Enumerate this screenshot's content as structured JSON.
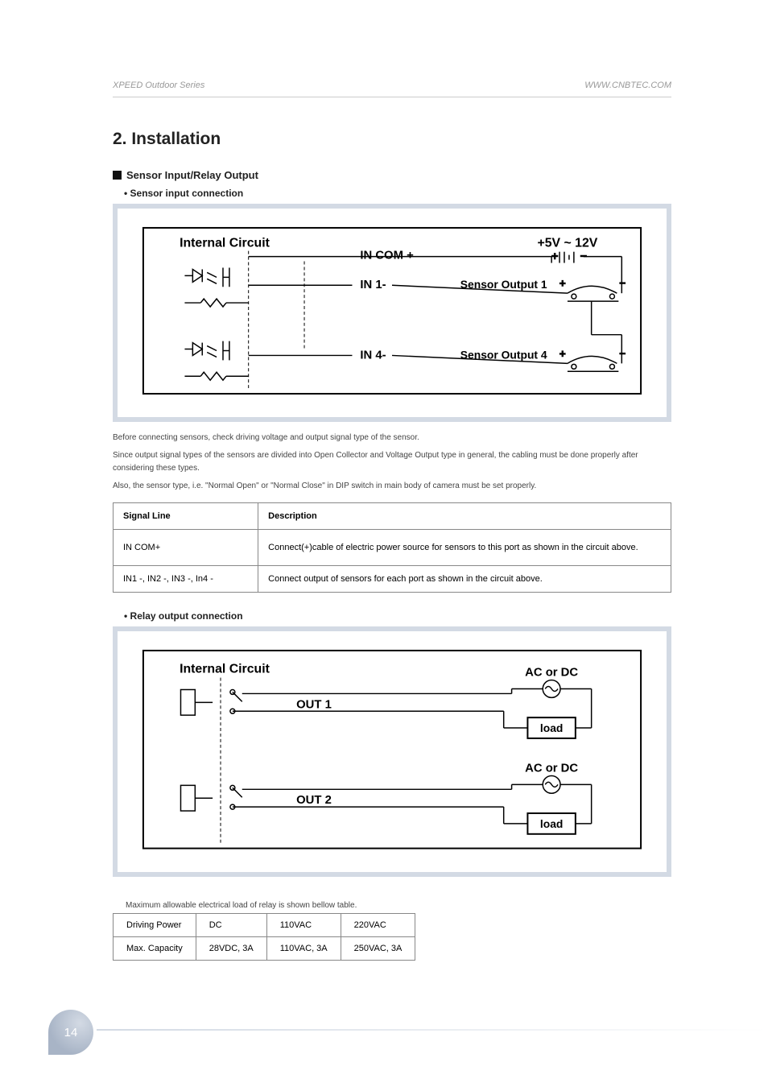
{
  "header": {
    "left": "XPEED Outdoor Series",
    "right": "WWW.CNBTEC.COM"
  },
  "title": "2. Installation",
  "section": "Sensor Input/Relay Output",
  "subsection1": "• Sensor input connection",
  "diagram1": {
    "internal_circuit": "Internal Circuit",
    "in_com": "IN COM +",
    "in1": "IN 1-",
    "in4": "IN 4-",
    "voltage": "+5V ~ 12V",
    "sensor_out1": "Sensor Output 1",
    "sensor_out4": "Sensor Output 4"
  },
  "notes": {
    "n1": "Before connecting sensors, check driving voltage and output signal type of the sensor.",
    "n2": "Since output signal types of the sensors are divided into Open Collector and Voltage Output type in general, the cabling must be done properly after considering these types.",
    "n3": "Also, the sensor type, i.e. \"Normal Open\" or \"Normal Close\" in DIP switch in main body of camera must be set properly."
  },
  "table1": {
    "h1": "Signal Line",
    "h2": "Description",
    "r1c1": "IN COM+",
    "r1c2": "Connect(+)cable of electric power source for sensors to this port as shown in the circuit above.",
    "r2c1": "IN1 -, IN2 -, IN3 -, In4 -",
    "r2c2": "Connect output of sensors for each port as shown in the circuit above."
  },
  "subsection2": "• Relay output connection",
  "diagram2": {
    "internal_circuit": "Internal Circuit",
    "out1": "OUT 1",
    "out2": "OUT 2",
    "acdc": "AC or DC",
    "load": "load"
  },
  "relay_note": "Maximum allowable electrical load of relay is shown bellow table.",
  "table2": {
    "h1": "Driving Power",
    "h2": "DC",
    "h3": "110VAC",
    "h4": "220VAC",
    "r1": "Max. Capacity",
    "c1": "28VDC, 3A",
    "c2": "110VAC, 3A",
    "c3": "250VAC, 3A"
  },
  "page_number": "14"
}
